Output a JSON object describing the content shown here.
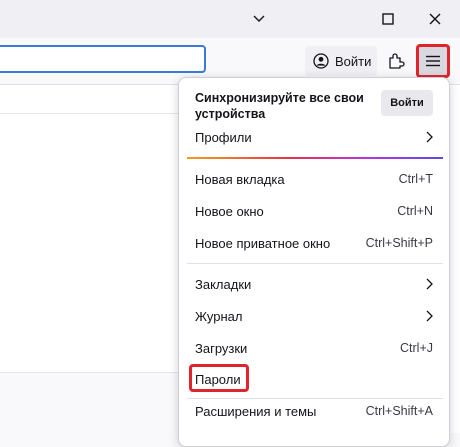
{
  "window": {
    "controls": [
      "chevron-down-icon",
      "maximize-icon",
      "close-icon"
    ]
  },
  "toolbar": {
    "signin_label": "Войти"
  },
  "menu": {
    "sync_title": "Синхронизируйте все свои устройства",
    "sync_button": "Войти",
    "profiles": "Профили",
    "new_tab": {
      "label": "Новая вкладка",
      "shortcut": "Ctrl+T"
    },
    "new_window": {
      "label": "Новое окно",
      "shortcut": "Ctrl+N"
    },
    "new_private": {
      "label": "Новое приватное окно",
      "shortcut": "Ctrl+Shift+P"
    },
    "bookmarks": "Закладки",
    "history": "Журнал",
    "downloads": {
      "label": "Загрузки",
      "shortcut": "Ctrl+J"
    },
    "passwords": "Пароли",
    "addons": {
      "label": "Расширения и темы",
      "shortcut": "Ctrl+Shift+A"
    }
  },
  "colors": {
    "highlight": "#e0242e",
    "urlbar_focus": "#3b7bd8"
  }
}
